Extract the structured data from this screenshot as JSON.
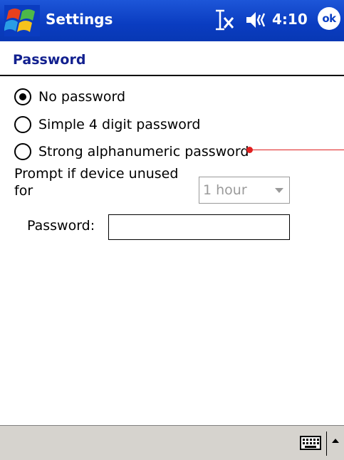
{
  "titlebar": {
    "title": "Settings",
    "clock": "4:10",
    "ok_label": "ok",
    "start_icon": "windows-flag-icon",
    "connectivity_icon": "connectivity-icon",
    "volume_icon": "speaker-icon",
    "background_color": "#0a3cc0"
  },
  "header": {
    "title": "Password",
    "title_color": "#12208f"
  },
  "options": [
    {
      "label": "No password",
      "selected": true
    },
    {
      "label": "Simple 4 digit password",
      "selected": false
    },
    {
      "label": "Strong alphanumeric password",
      "selected": false
    }
  ],
  "prompt": {
    "label": "Prompt if device unused for",
    "selected_value": "1 hour",
    "enabled": false
  },
  "password_field": {
    "label": "Password:",
    "value": ""
  },
  "menubar": {
    "keyboard_icon": "keyboard-icon",
    "sip_arrow_icon": "chevron-up-icon"
  },
  "annotation": {
    "color": "#e02020"
  }
}
